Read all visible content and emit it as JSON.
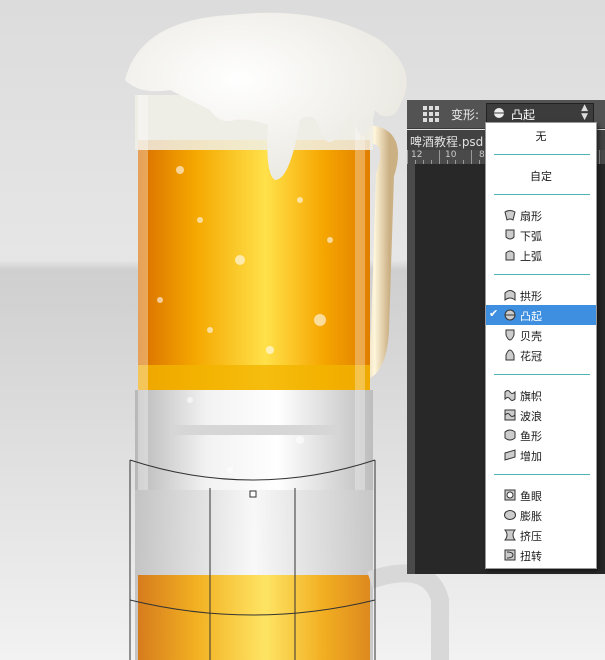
{
  "options_bar": {
    "warp_label": "变形:",
    "selected_value": "凸起"
  },
  "document_tab": {
    "title": "啤酒教程.psd @"
  },
  "ruler": {
    "labels": [
      "12",
      "10",
      "8"
    ]
  },
  "warp_menu": {
    "groups": [
      [
        {
          "label": "无",
          "icon": "none"
        }
      ],
      [
        {
          "label": "自定",
          "icon": "none"
        }
      ],
      [
        {
          "label": "扇形",
          "icon": "arc-icon"
        },
        {
          "label": "下弧",
          "icon": "arc-lower-icon"
        },
        {
          "label": "上弧",
          "icon": "arc-upper-icon"
        }
      ],
      [
        {
          "label": "拱形",
          "icon": "arch-icon"
        },
        {
          "label": "凸起",
          "icon": "bulge-icon",
          "selected": true
        },
        {
          "label": "贝壳",
          "icon": "shell-lower-icon"
        },
        {
          "label": "花冠",
          "icon": "shell-upper-icon"
        }
      ],
      [
        {
          "label": "旗帜",
          "icon": "flag-icon"
        },
        {
          "label": "波浪",
          "icon": "wave-icon"
        },
        {
          "label": "鱼形",
          "icon": "fish-icon"
        },
        {
          "label": "增加",
          "icon": "rise-icon"
        }
      ],
      [
        {
          "label": "鱼眼",
          "icon": "fisheye-icon"
        },
        {
          "label": "膨胀",
          "icon": "inflate-icon"
        },
        {
          "label": "挤压",
          "icon": "squeeze-icon"
        },
        {
          "label": "扭转",
          "icon": "twist-icon"
        }
      ]
    ]
  },
  "colors": {
    "beer_dark": "#e08a00",
    "beer_light": "#ffd21a",
    "foam": "#f7f6f1",
    "menu_highlight": "#3e8fe0",
    "menu_separator": "#4fb2b0",
    "panel_dark": "#282828",
    "options_bar": "#535353"
  }
}
